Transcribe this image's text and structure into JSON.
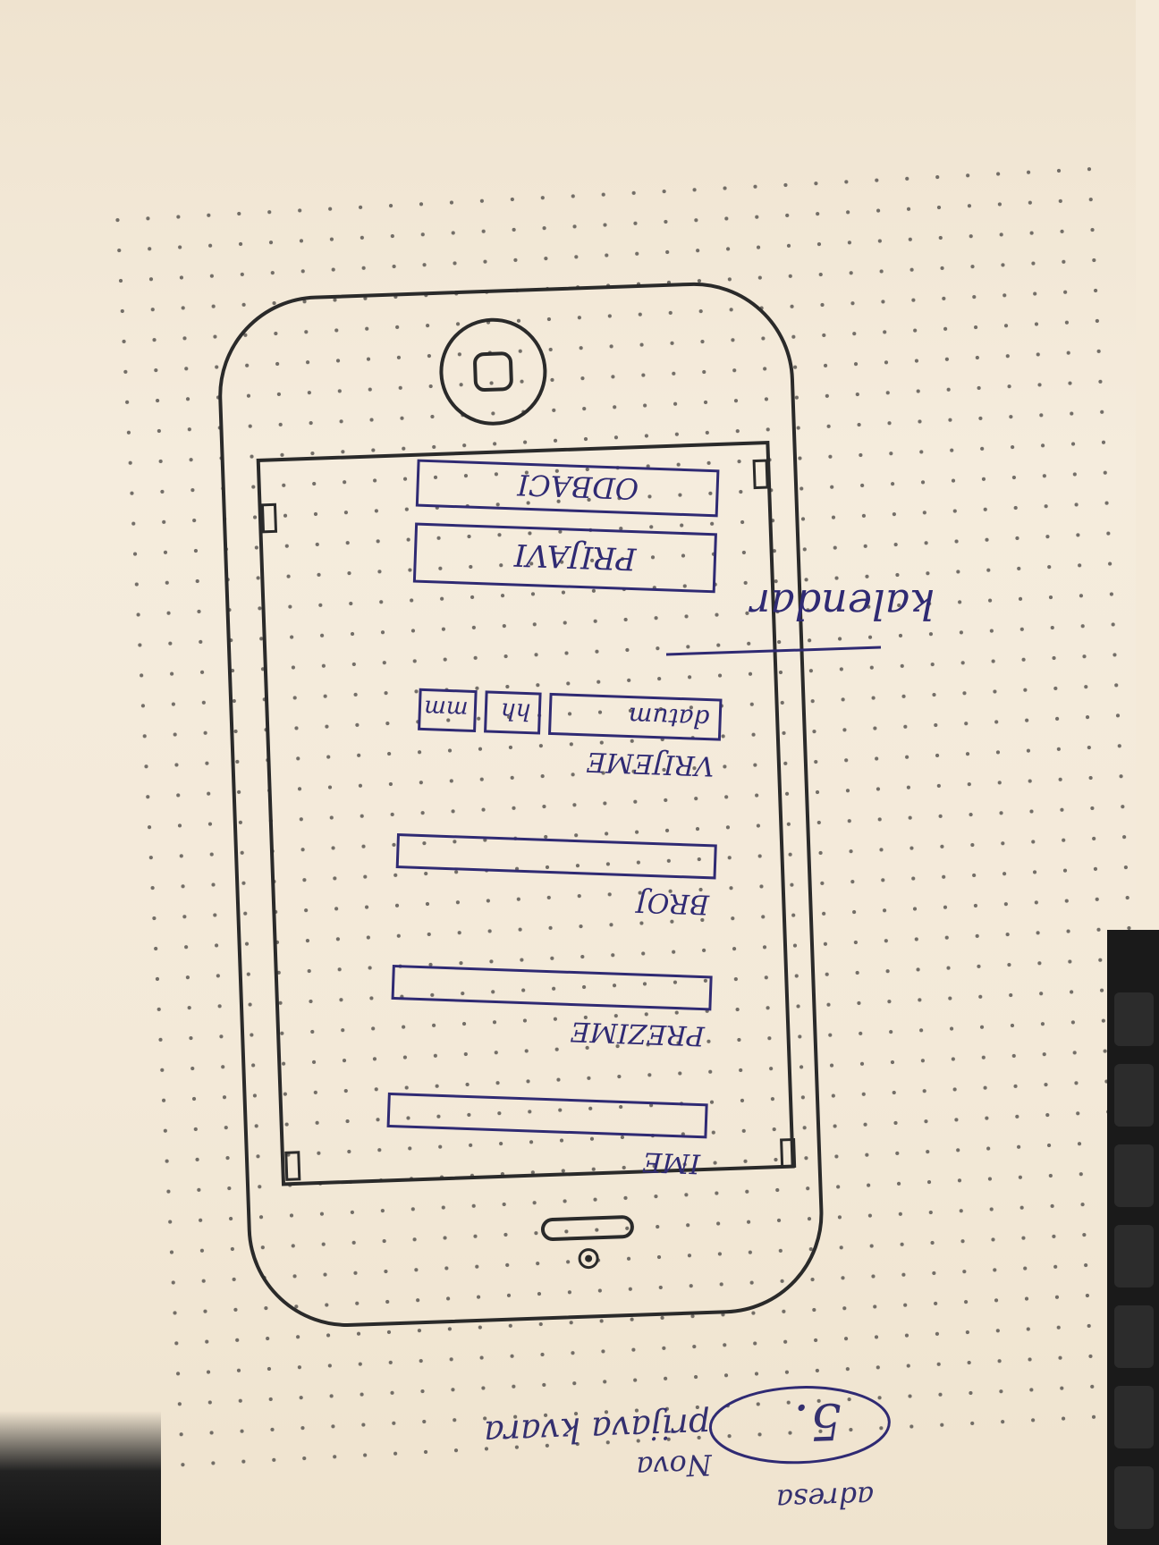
{
  "sketch": {
    "form_labels": {
      "name": "IME",
      "surname": "PREZIME",
      "number": "BROJ",
      "time": "VRIJEME"
    },
    "date_field_text": "datum",
    "hours_box": "hh",
    "minutes_box": "mm",
    "buttons": {
      "submit": "PRIJAVI",
      "cancel": "ODBACI"
    },
    "annotation": "kalendar",
    "note": {
      "number": "5.",
      "line1": "prijava kvara",
      "line2": "Nova",
      "line3": "adresa"
    }
  }
}
